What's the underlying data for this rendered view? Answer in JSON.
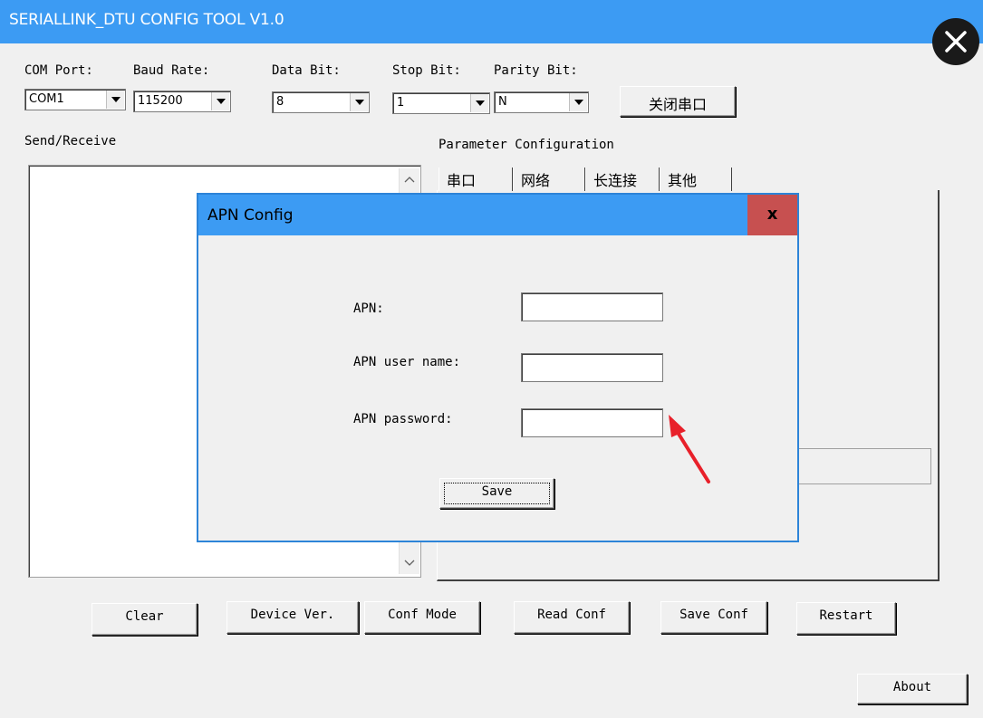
{
  "window": {
    "title": "SERIALLINK_DTU CONFIG TOOL V1.0",
    "close_glyph": "×",
    "accent": "#3c9bf3"
  },
  "serial": {
    "com_port_label": "COM Port:",
    "com_port_value": "COM1",
    "baud_label": "Baud Rate:",
    "baud_value": "115200",
    "databit_label": "Data Bit:",
    "databit_value": "8",
    "stopbit_label": "Stop Bit:",
    "stopbit_value": "1",
    "parity_label": "Parity Bit:",
    "parity_value": "N",
    "close_port_button": "关闭串口"
  },
  "send_receive": {
    "label": "Send/Receive",
    "text": ""
  },
  "parameters": {
    "label": "Parameter Configuration",
    "tabs": [
      "串口",
      "网络",
      "长连接",
      "其他"
    ]
  },
  "dialog": {
    "title": "APN Config",
    "close_label": "x",
    "close_color": "#c75050",
    "fields": [
      {
        "label": "APN:",
        "value": ""
      },
      {
        "label": "APN user name:",
        "value": ""
      },
      {
        "label": "APN password:",
        "value": ""
      }
    ],
    "save_button": "Save"
  },
  "bottom_buttons": {
    "clear": "Clear",
    "device_ver": "Device Ver.",
    "conf_mode": "Conf Mode",
    "read_conf": "Read Conf",
    "save_conf": "Save Conf",
    "restart": "Restart",
    "about": "About"
  },
  "annotation": {
    "arrow_color": "#e8202a",
    "icon": "red-arrow-icon"
  }
}
